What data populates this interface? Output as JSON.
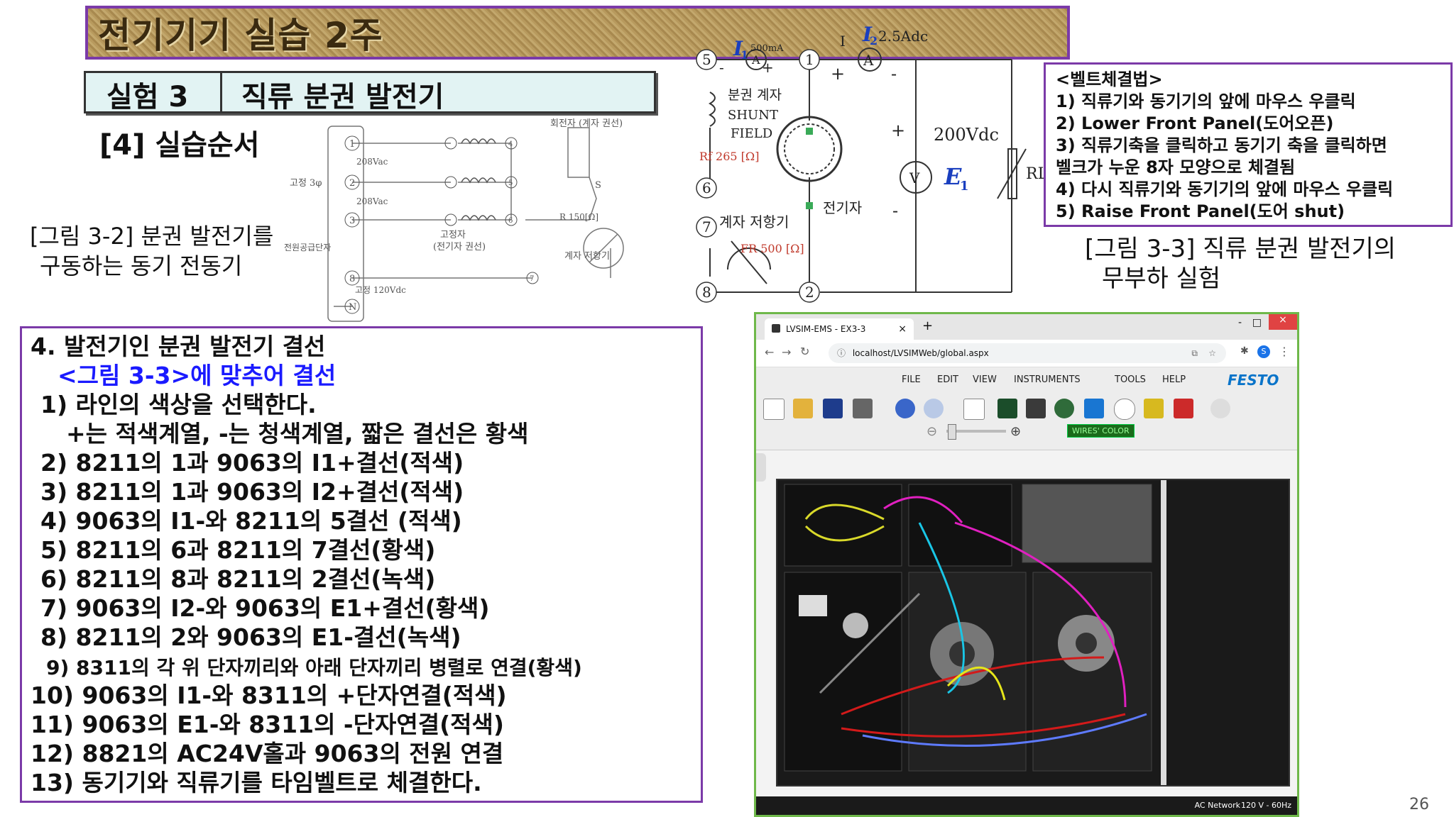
{
  "title": "전기기기 실습 2주",
  "experiment": {
    "number": "실험 3",
    "name": "직류 분권 발전기"
  },
  "step_title": "[4] 실습순서",
  "fig32": {
    "caption_l1": "[그림 3-2] 분권 발전기를",
    "caption_l2": "구동하는 동기 전동기",
    "rotor_label": "회전자 (계자 권선)",
    "fixed_3phase": "고정 3φ",
    "v208a": "208Vac",
    "v208b": "208Vac",
    "supply": "전원공급단자",
    "stator_l1": "고정자",
    "stator_l2": "(전기자 권선)",
    "r150": "R 150[Ω]",
    "field_res": "계자 저항기",
    "v120": "고정 120Vdc",
    "s": "S",
    "n": "N",
    "t1": "1",
    "t2": "2",
    "t3": "3",
    "t4": "4",
    "t5": "5",
    "t6": "6",
    "t7": "7",
    "t8": "8"
  },
  "fig33": {
    "caption_l1": "[그림 3-3] 직류 분권 발전기의",
    "caption_l2": "무부하 실험",
    "i1_sym": "I",
    "i1_sub": "1",
    "i1_val": "500mA",
    "i2_sym": "I",
    "i2_sub": "2",
    "i2_val": "2.5Adc",
    "i_label": "I",
    "shunt_1": "분권 계자",
    "shunt_2": "SHUNT",
    "shunt_3": "FIELD",
    "rf": "Rf 265 [Ω]",
    "armature": "전기자",
    "field_res": "계자 저항기",
    "fr": "FR 500 [Ω]",
    "v200": "200Vdc",
    "e1_sym": "E",
    "e1_sub": "1",
    "rl": "RL",
    "t1": "1",
    "t2": "2",
    "t5": "5",
    "t6": "6",
    "t7": "7",
    "t8": "8",
    "ammeter": "A",
    "voltmeter": "V",
    "plus": "+",
    "minus": "-"
  },
  "belt": [
    "<벨트체결법>",
    "1) 직류기와 동기기의 앞에 마우스 우클릭",
    "2) Lower Front Panel(도어오픈)",
    "3) 직류기축을 클릭하고 동기기 축을 클릭하면",
    "벨크가 누운 8자 모양으로 체결됨",
    "4) 다시 직류기와 동기기의 앞에 마우스 우클릭",
    "5) Raise Front Panel(도어 shut)"
  ],
  "wiring": {
    "heading": "4. 발전기인 분권 발전기 결선",
    "sub": "<그림 3-3>에 맞추어 결선",
    "lines": [
      "1) 라인의 색상을 선택한다.",
      "+는 적색계열, -는 청색계열, 짧은 결선은 황색",
      "2) 8211의 1과 9063의 I1+결선(적색)",
      "3) 8211의 1과 9063의 I2+결선(적색)",
      "4) 9063의 I1-와 8211의 5결선 (적색)",
      "5) 8211의 6과 8211의 7결선(황색)",
      "6) 8211의 8과 8211의 2결선(녹색)",
      "7) 9063의 I2-와 9063의 E1+결선(황색)",
      "8) 8211의 2와 9063의 E1-결선(녹색)",
      "9) 8311의 각 위 단자끼리와 아래 단자끼리 병렬로 연결(황색)",
      "10) 9063의 I1-와 8311의 +단자연결(적색)",
      "11) 9063의 E1-와 8311의 -단자연결(적색)",
      "12) 8821의 AC24V홀과 9063의 전원 연결",
      "13) 동기기와 직류기를 타임벨트로 체결한다."
    ]
  },
  "browser": {
    "tab_title": "LVSIM-EMS - EX3-3",
    "tab_close": "×",
    "new_tab": "+",
    "url": "localhost/LVSIMWeb/global.aspx",
    "profile": "S",
    "menu": [
      "FILE",
      "EDIT",
      "VIEW",
      "INSTRUMENTS",
      "TOOLS",
      "HELP"
    ],
    "brand": "FESTO",
    "wires_color": "WIRES' COLOR",
    "status_left": "AC Network",
    "status_right": "120 V - 60Hz",
    "win_min": "-",
    "win_max": "□",
    "win_close": "×"
  },
  "page_number": "26"
}
